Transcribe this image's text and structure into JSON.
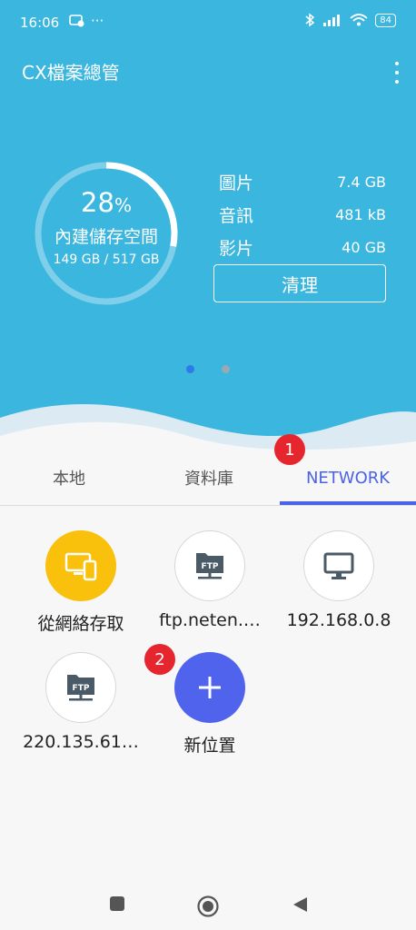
{
  "status_bar": {
    "time": "16:06",
    "overflow": "···",
    "battery": "84"
  },
  "app_bar": {
    "title": "CX檔案總管",
    "menu_icon": "more-vert-icon"
  },
  "storage": {
    "used_fraction": 0.28,
    "percent_number": "28",
    "percent_sign": "%",
    "label": "內建儲存空間",
    "capacity": "149 GB / 517 GB",
    "categories": [
      {
        "name": "圖片",
        "size": "7.4 GB"
      },
      {
        "name": "音訊",
        "size": "481 kB"
      },
      {
        "name": "影片",
        "size": "40 GB"
      }
    ],
    "clean_label": "清理",
    "pager": {
      "pages": 2,
      "current": 1
    }
  },
  "tabs": [
    {
      "label": "本地",
      "active": false
    },
    {
      "label": "資料庫",
      "active": false
    },
    {
      "label": "NETWORK",
      "active": true
    }
  ],
  "badges": [
    "1",
    "2"
  ],
  "network_items": [
    {
      "label": "從網絡存取",
      "icon": "devices-icon",
      "style": "yellow"
    },
    {
      "label": "ftp.neten.…",
      "icon": "ftp-server-icon",
      "style": "white"
    },
    {
      "label": "192.168.0.8",
      "icon": "monitor-icon",
      "style": "white"
    },
    {
      "label": "220.135.61…",
      "icon": "ftp-server-icon",
      "style": "white"
    },
    {
      "label": "新位置",
      "icon": "plus-icon",
      "style": "blue"
    }
  ],
  "ftp_icon_text": "FTP",
  "colors": {
    "hero": "#3bb6df",
    "accent": "#4b63e6",
    "badge": "#e5262e",
    "yellow": "#f9c00c"
  }
}
